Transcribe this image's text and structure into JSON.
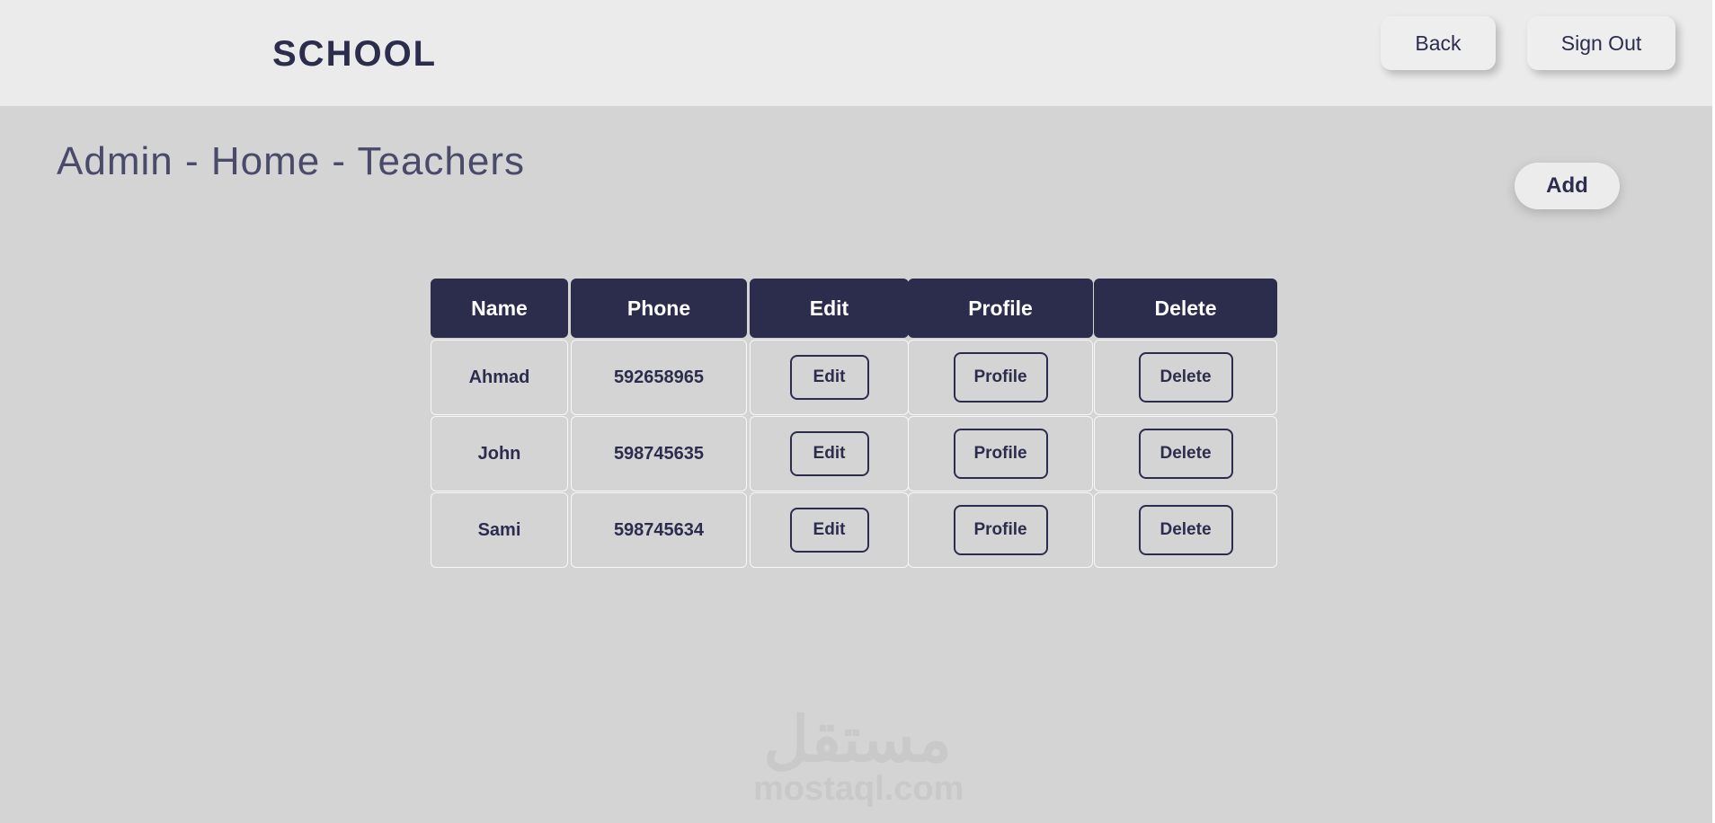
{
  "header": {
    "logo": "SCHOOL",
    "back_label": "Back",
    "signout_label": "Sign Out"
  },
  "page": {
    "title": "Admin - Home - Teachers",
    "add_label": "Add"
  },
  "table": {
    "headers": [
      "Name",
      "Phone",
      "Edit",
      "Profile",
      "Delete"
    ],
    "rows": [
      {
        "name": "Ahmad",
        "phone": "592658965"
      },
      {
        "name": "John",
        "phone": "598745635"
      },
      {
        "name": "Sami",
        "phone": "598745634"
      }
    ],
    "edit_label": "Edit",
    "profile_label": "Profile",
    "delete_label": "Delete"
  },
  "watermark": {
    "arabic": "مستقل",
    "latin": "mostaql.com"
  },
  "colors": {
    "navy": "#2c2d4d",
    "background": "#d4d4d4",
    "header_bg": "#ebebeb"
  }
}
